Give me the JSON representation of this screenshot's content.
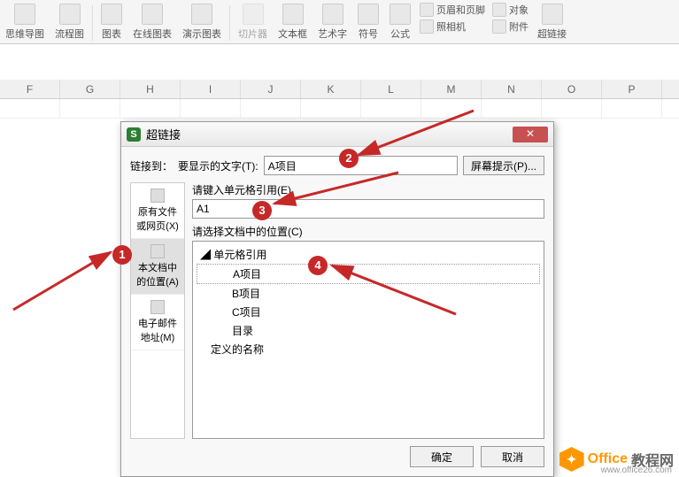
{
  "ribbon": {
    "mindmap": "思维导图",
    "flowchart": "流程图",
    "chart": "图表",
    "online_chart": "在线图表",
    "presentation_chart": "演示图表",
    "slicer": "切片器",
    "textbox": "文本框",
    "wordart": "艺术字",
    "symbol": "符号",
    "formula": "公式",
    "header_footer": "页眉和页脚",
    "object": "对象",
    "camera": "照相机",
    "attachment": "附件",
    "hyperlink": "超链接"
  },
  "columns": [
    "F",
    "G",
    "H",
    "I",
    "J",
    "K",
    "L",
    "M",
    "N",
    "O",
    "P"
  ],
  "dialog": {
    "title": "超链接",
    "link_to_label": "链接到：",
    "display_text_label": "要显示的文字(T):",
    "display_text_value": "A项目",
    "tooltip_btn": "屏幕提示(P)...",
    "ref_label": "请键入单元格引用(E)",
    "ref_value": "A1",
    "pos_label": "请选择文档中的位置(C)",
    "side_tabs": {
      "existing": "原有文件或网页(X)",
      "in_doc": "本文档中的位置(A)",
      "email": "电子邮件地址(M)"
    },
    "tree": {
      "group1": "单元格引用",
      "items": [
        "A项目",
        "B项目",
        "C项目",
        "目录"
      ],
      "group2": "定义的名称"
    },
    "ok": "确定",
    "cancel": "取消"
  },
  "callouts": {
    "c1": "1",
    "c2": "2",
    "c3": "3",
    "c4": "4"
  },
  "watermark": {
    "brand": "Office",
    "suffix": "教程网",
    "url": "www.office26.com"
  }
}
